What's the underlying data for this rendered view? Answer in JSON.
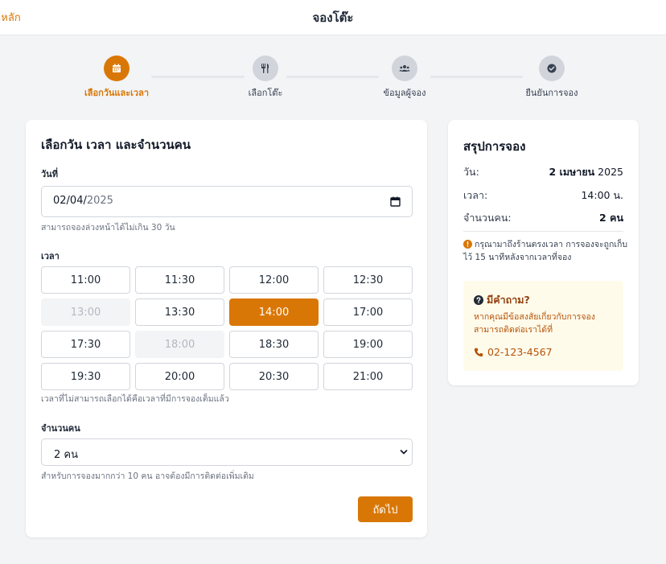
{
  "header": {
    "back_label": "ำหลัก",
    "title": "จองโต๊ะ"
  },
  "stepper": {
    "steps": [
      {
        "label": "เลือกวันและเวลา",
        "icon": "calendar-icon",
        "active": true
      },
      {
        "label": "เลือกโต๊ะ",
        "icon": "utensils-icon",
        "active": false
      },
      {
        "label": "ข้อมูลผู้จอง",
        "icon": "users-icon",
        "active": false
      },
      {
        "label": "ยืนยันการจอง",
        "icon": "check-circle-icon",
        "active": false
      }
    ]
  },
  "form": {
    "heading": "เลือกวัน เวลา และจำนวนคน",
    "date": {
      "label": "วันที่",
      "value_day_month": "02/04/",
      "value_year": "2025",
      "hint": "สามารถจองล่วงหน้าได้ไม่เกิน 30 วัน"
    },
    "time": {
      "label": "เวลา",
      "slots": [
        {
          "time": "11:00",
          "state": "available"
        },
        {
          "time": "11:30",
          "state": "available"
        },
        {
          "time": "12:00",
          "state": "available"
        },
        {
          "time": "12:30",
          "state": "available"
        },
        {
          "time": "13:00",
          "state": "disabled"
        },
        {
          "time": "13:30",
          "state": "available"
        },
        {
          "time": "14:00",
          "state": "selected"
        },
        {
          "time": "17:00",
          "state": "available"
        },
        {
          "time": "17:30",
          "state": "available"
        },
        {
          "time": "18:00",
          "state": "disabled"
        },
        {
          "time": "18:30",
          "state": "available"
        },
        {
          "time": "19:00",
          "state": "available"
        },
        {
          "time": "19:30",
          "state": "available"
        },
        {
          "time": "20:00",
          "state": "available"
        },
        {
          "time": "20:30",
          "state": "available"
        },
        {
          "time": "21:00",
          "state": "available"
        }
      ],
      "hint": "เวลาที่ไม่สามารถเลือกได้คือเวลาที่มีการจองเต็มแล้ว"
    },
    "guests": {
      "label": "จำนวนคน",
      "selected": "2 คน",
      "hint": "สำหรับการจองมากกว่า 10 คน อาจต้องมีการติดต่อเพิ่มเติม"
    },
    "next_label": "ถัดไป"
  },
  "summary": {
    "heading": "สรุปการจอง",
    "rows": [
      {
        "label": "วัน:",
        "value_bold": "2 เมษายน",
        "value_rest": " 2025"
      },
      {
        "label": "เวลา:",
        "value_bold": "",
        "value_rest": "14:00 น."
      },
      {
        "label": "จำนวนคน:",
        "value_bold": "2 คน",
        "value_rest": ""
      }
    ],
    "note": "กรุณามาถึงร้านตรงเวลา การจองจะถูกเก็บไว้ 15 นาทีหลังจากเวลาที่จอง",
    "help": {
      "title": "มีคำถาม?",
      "text": "หากคุณมีข้อสงสัยเกี่ยวกับการจอง สามารถติดต่อเราได้ที่",
      "phone": "02-123-4567"
    }
  },
  "colors": {
    "accent": "#d97706",
    "disabled_bg": "#f3f4f6",
    "help_bg": "#fffbeb"
  }
}
